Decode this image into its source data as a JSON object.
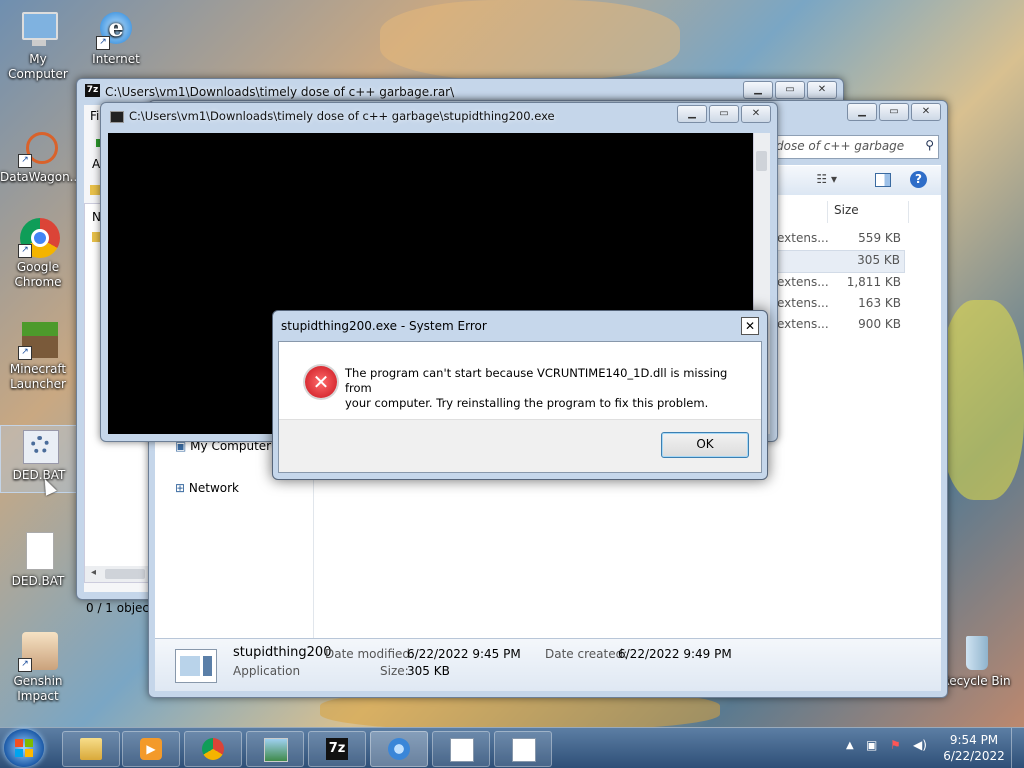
{
  "desktop": {
    "icons": [
      {
        "label": "My Computer",
        "icon": "computer-icon"
      },
      {
        "label": "Internet",
        "icon": "internet-explorer-icon"
      },
      {
        "label": "DataWagon...",
        "icon": "datawagon-icon"
      },
      {
        "label": "Google Chrome",
        "icon": "chrome-icon"
      },
      {
        "label": "Minecraft Launcher",
        "icon": "minecraft-icon"
      },
      {
        "label": "DED.BAT",
        "icon": "bat-settings-icon"
      },
      {
        "label": "DED.BAT",
        "icon": "document-icon"
      },
      {
        "label": "Genshin Impact",
        "icon": "genshin-icon"
      },
      {
        "label": "Recycle Bin",
        "icon": "recycle-bin-icon"
      }
    ]
  },
  "zip_window": {
    "title": "C:\\Users\\vm1\\Downloads\\timely dose of c++ garbage.rar\\",
    "menu_first": "Fi",
    "toolbar_letter": "A",
    "col_letter": "N",
    "status": "0 / 1 object("
  },
  "explorer_window": {
    "search_text": "dose of c++ garbage",
    "col_size": "Size",
    "rows": [
      {
        "type": "extens...",
        "size": "559 KB"
      },
      {
        "type": "",
        "size": "305 KB"
      },
      {
        "type": "extens...",
        "size": "1,811 KB"
      },
      {
        "type": "extens...",
        "size": "163 KB"
      },
      {
        "type": "extens...",
        "size": "900 KB"
      }
    ],
    "nav": [
      "My Computer",
      "Network"
    ],
    "details": {
      "name": "stupidthing200",
      "type": "Application",
      "modified_label": "Date modified:",
      "modified_value": "6/22/2022 9:45 PM",
      "created_label": "Date created:",
      "created_value": "6/22/2022 9:49 PM",
      "size_label": "Size:",
      "size_value": "305 KB"
    }
  },
  "console_window": {
    "title": "C:\\Users\\vm1\\Downloads\\timely dose of c++ garbage\\stupidthing200.exe"
  },
  "error_dialog": {
    "title": "stupidthing200.exe - System Error",
    "message_line1": "The program can't start because VCRUNTIME140_1D.dll is missing from",
    "message_line2": "your computer. Try reinstalling the program to fix this problem.",
    "ok_label": "OK",
    "close_glyph": "✕"
  },
  "taskbar": {
    "time": "9:54 PM",
    "date": "6/22/2022",
    "items": [
      "explorer",
      "media-player",
      "chrome",
      "photo-viewer",
      "7zip",
      "chrome-alt",
      "app-window",
      "app-window"
    ]
  },
  "colors": {
    "error_red": "#c8141e",
    "taskbar": "#3b5c84"
  }
}
